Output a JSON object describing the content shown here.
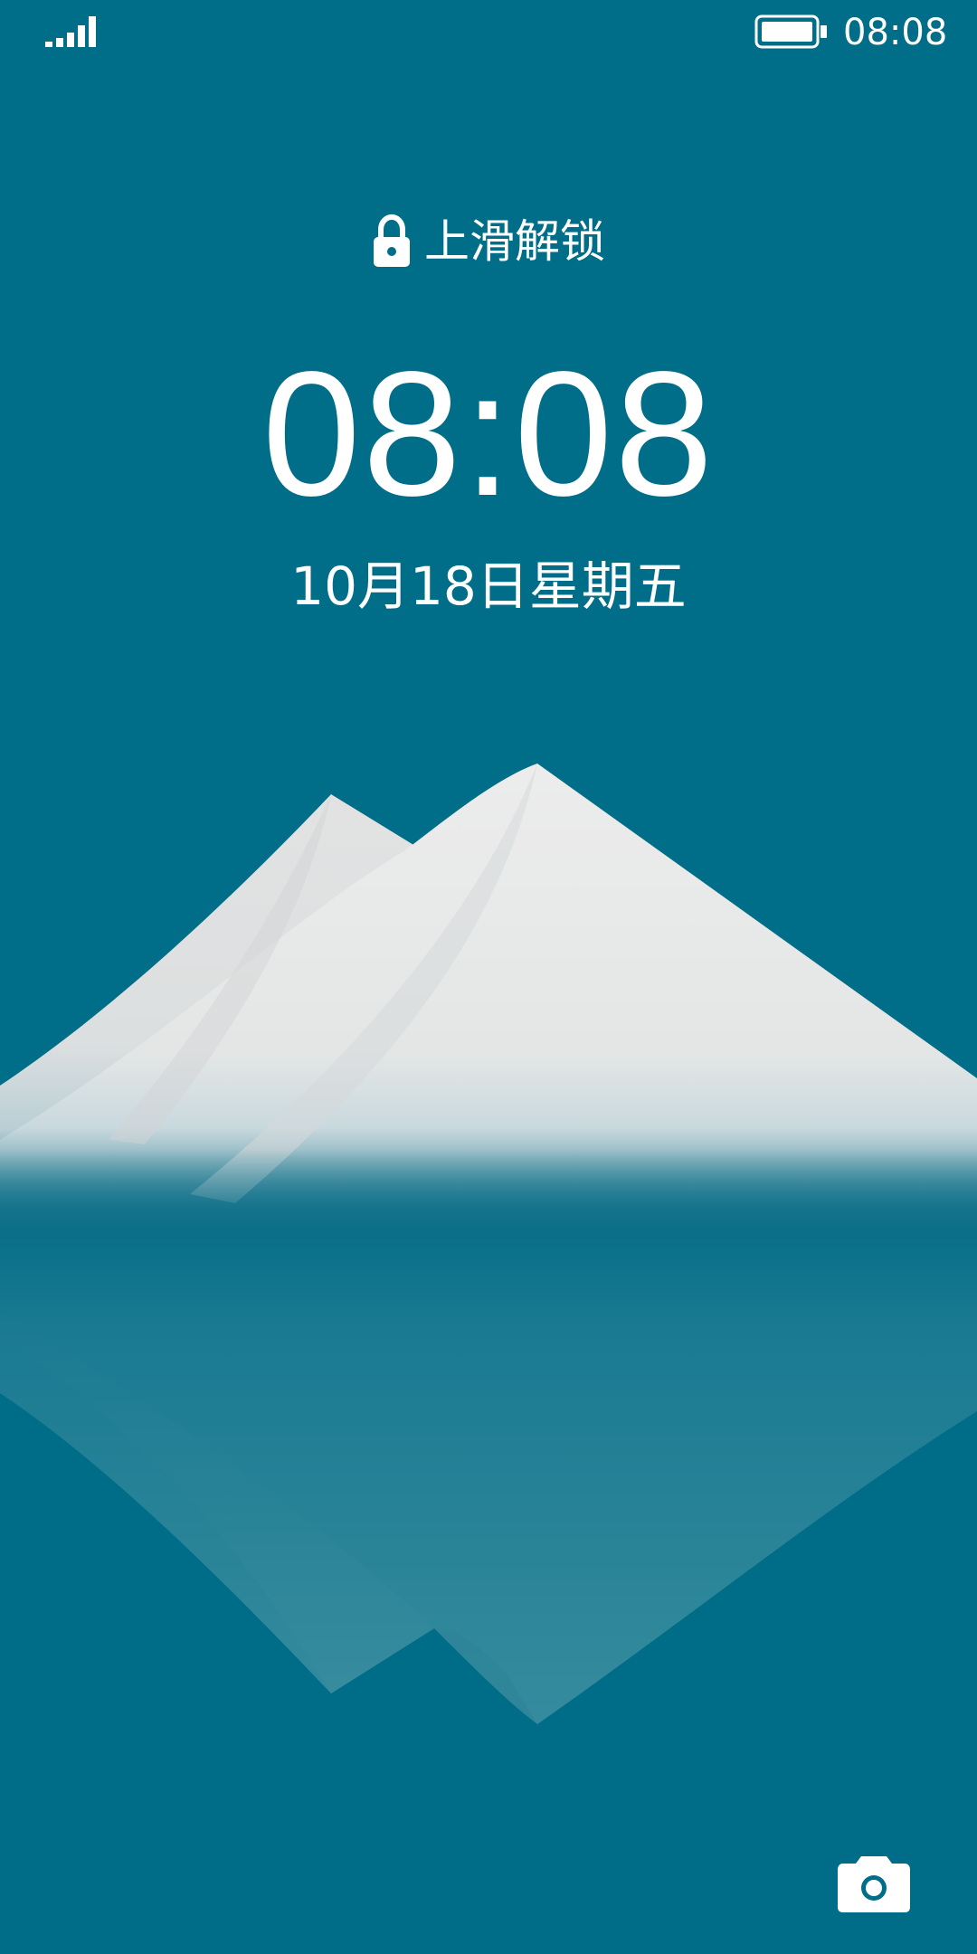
{
  "status_bar": {
    "signal_icon": "signal-strength-icon",
    "battery_icon": "battery-full-icon",
    "time": "08:08"
  },
  "lock_screen": {
    "lock_icon": "lock-icon",
    "unlock_hint": "上滑解锁",
    "clock": "08:08",
    "date": "10月18日星期五"
  },
  "shortcuts": {
    "camera_icon": "camera-icon"
  },
  "colors": {
    "background": "#006e89",
    "text": "#ffffff",
    "mountain": "#e6e6e6"
  }
}
